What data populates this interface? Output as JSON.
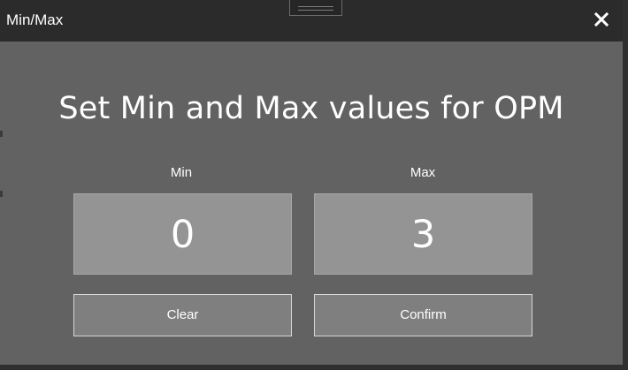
{
  "window": {
    "title": "Min/Max",
    "close_icon": "close-icon"
  },
  "dialog": {
    "heading": "Set Min and Max values for OPM",
    "min": {
      "label": "Min",
      "value": "0"
    },
    "max": {
      "label": "Max",
      "value": "3"
    },
    "buttons": {
      "clear": "Clear",
      "confirm": "Confirm"
    }
  },
  "colors": {
    "titlebar": "#2b2b2b",
    "dialog_background": "#626262",
    "value_box": "#949494",
    "button": "#7f7f7f",
    "text": "#ffffff"
  }
}
